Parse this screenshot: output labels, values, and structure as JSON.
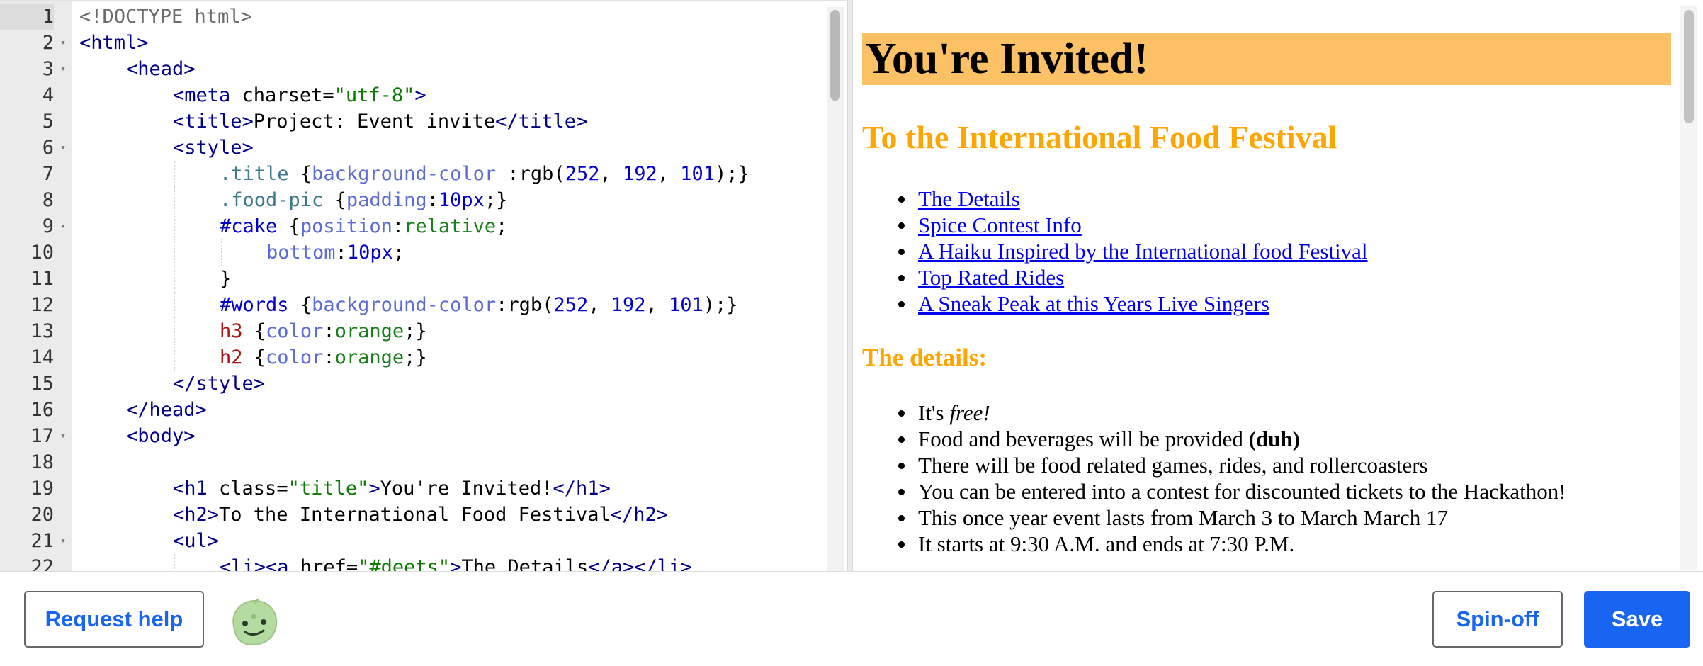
{
  "editor": {
    "lines": [
      {
        "n": "1",
        "fold": "",
        "indent": 0,
        "parts": [
          {
            "c": "t-doctype",
            "t": "<!DOCTYPE html>"
          }
        ]
      },
      {
        "n": "2",
        "fold": "▾",
        "indent": 0,
        "parts": [
          {
            "c": "t-tag",
            "t": "<html>"
          }
        ]
      },
      {
        "n": "3",
        "fold": "▾",
        "indent": 1,
        "parts": [
          {
            "c": "t-tag",
            "t": "<head>"
          }
        ]
      },
      {
        "n": "4",
        "fold": "",
        "indent": 2,
        "parts": [
          {
            "c": "t-tag",
            "t": "<meta "
          },
          {
            "c": "t-attr",
            "t": "charset"
          },
          {
            "c": "t-eq",
            "t": "="
          },
          {
            "c": "t-str",
            "t": "\"utf-8\""
          },
          {
            "c": "t-tag",
            "t": ">"
          }
        ]
      },
      {
        "n": "5",
        "fold": "",
        "indent": 2,
        "parts": [
          {
            "c": "t-tag",
            "t": "<title>"
          },
          {
            "c": "t-text",
            "t": "Project: Event invite"
          },
          {
            "c": "t-tag",
            "t": "</title>"
          }
        ]
      },
      {
        "n": "6",
        "fold": "▾",
        "indent": 2,
        "parts": [
          {
            "c": "t-tag",
            "t": "<style>"
          }
        ]
      },
      {
        "n": "7",
        "fold": "",
        "indent": 3,
        "parts": [
          {
            "c": "t-class",
            "t": ".title "
          },
          {
            "c": "t-punc",
            "t": "{"
          },
          {
            "c": "t-prop",
            "t": "background-color "
          },
          {
            "c": "t-punc",
            "t": ":rgb("
          },
          {
            "c": "t-num",
            "t": "252"
          },
          {
            "c": "t-punc",
            "t": ", "
          },
          {
            "c": "t-num",
            "t": "192"
          },
          {
            "c": "t-punc",
            "t": ", "
          },
          {
            "c": "t-num",
            "t": "101"
          },
          {
            "c": "t-punc",
            "t": ");}"
          }
        ]
      },
      {
        "n": "8",
        "fold": "",
        "indent": 3,
        "parts": [
          {
            "c": "t-class",
            "t": ".food-pic "
          },
          {
            "c": "t-punc",
            "t": "{"
          },
          {
            "c": "t-prop",
            "t": "padding"
          },
          {
            "c": "t-punc",
            "t": ":"
          },
          {
            "c": "t-num",
            "t": "10px"
          },
          {
            "c": "t-punc",
            "t": ";}"
          }
        ]
      },
      {
        "n": "9",
        "fold": "▾",
        "indent": 3,
        "parts": [
          {
            "c": "t-id",
            "t": "#cake "
          },
          {
            "c": "t-punc",
            "t": "{"
          },
          {
            "c": "t-prop",
            "t": "position"
          },
          {
            "c": "t-punc",
            "t": ":"
          },
          {
            "c": "t-val",
            "t": "relative"
          },
          {
            "c": "t-punc",
            "t": ";"
          }
        ]
      },
      {
        "n": "10",
        "fold": "",
        "indent": 4,
        "parts": [
          {
            "c": "t-prop",
            "t": "bottom"
          },
          {
            "c": "t-punc",
            "t": ":"
          },
          {
            "c": "t-num",
            "t": "10px"
          },
          {
            "c": "t-punc",
            "t": ";"
          }
        ]
      },
      {
        "n": "11",
        "fold": "",
        "indent": 3,
        "parts": [
          {
            "c": "t-punc",
            "t": "}"
          }
        ]
      },
      {
        "n": "12",
        "fold": "",
        "indent": 3,
        "parts": [
          {
            "c": "t-id",
            "t": "#words "
          },
          {
            "c": "t-punc",
            "t": "{"
          },
          {
            "c": "t-prop",
            "t": "background-color"
          },
          {
            "c": "t-punc",
            "t": ":rgb("
          },
          {
            "c": "t-num",
            "t": "252"
          },
          {
            "c": "t-punc",
            "t": ", "
          },
          {
            "c": "t-num",
            "t": "192"
          },
          {
            "c": "t-punc",
            "t": ", "
          },
          {
            "c": "t-num",
            "t": "101"
          },
          {
            "c": "t-punc",
            "t": ");}"
          }
        ]
      },
      {
        "n": "13",
        "fold": "",
        "indent": 3,
        "parts": [
          {
            "c": "t-el",
            "t": "h3 "
          },
          {
            "c": "t-punc",
            "t": "{"
          },
          {
            "c": "t-prop",
            "t": "color"
          },
          {
            "c": "t-punc",
            "t": ":"
          },
          {
            "c": "t-val",
            "t": "orange"
          },
          {
            "c": "t-punc",
            "t": ";}"
          }
        ]
      },
      {
        "n": "14",
        "fold": "",
        "indent": 3,
        "parts": [
          {
            "c": "t-el",
            "t": "h2 "
          },
          {
            "c": "t-punc",
            "t": "{"
          },
          {
            "c": "t-prop",
            "t": "color"
          },
          {
            "c": "t-punc",
            "t": ":"
          },
          {
            "c": "t-val",
            "t": "orange"
          },
          {
            "c": "t-punc",
            "t": ";}"
          }
        ]
      },
      {
        "n": "15",
        "fold": "",
        "indent": 2,
        "parts": [
          {
            "c": "t-tag",
            "t": "</style>"
          }
        ]
      },
      {
        "n": "16",
        "fold": "",
        "indent": 1,
        "parts": [
          {
            "c": "t-tag",
            "t": "</head>"
          }
        ]
      },
      {
        "n": "17",
        "fold": "▾",
        "indent": 1,
        "parts": [
          {
            "c": "t-tag",
            "t": "<body>"
          }
        ]
      },
      {
        "n": "18",
        "fold": "",
        "indent": 1,
        "parts": []
      },
      {
        "n": "19",
        "fold": "",
        "indent": 2,
        "parts": [
          {
            "c": "t-tag",
            "t": "<h1 "
          },
          {
            "c": "t-attr",
            "t": "class"
          },
          {
            "c": "t-eq",
            "t": "="
          },
          {
            "c": "t-str",
            "t": "\"title\""
          },
          {
            "c": "t-tag",
            "t": ">"
          },
          {
            "c": "t-text",
            "t": "You're Invited!"
          },
          {
            "c": "t-tag",
            "t": "</h1>"
          }
        ]
      },
      {
        "n": "20",
        "fold": "",
        "indent": 2,
        "parts": [
          {
            "c": "t-tag",
            "t": "<h2>"
          },
          {
            "c": "t-text",
            "t": "To the International Food Festival"
          },
          {
            "c": "t-tag",
            "t": "</h2>"
          }
        ]
      },
      {
        "n": "21",
        "fold": "▾",
        "indent": 2,
        "parts": [
          {
            "c": "t-tag",
            "t": "<ul>"
          }
        ]
      },
      {
        "n": "22",
        "fold": "",
        "indent": 3,
        "parts": [
          {
            "c": "t-tag",
            "t": "<li><a "
          },
          {
            "c": "t-attr",
            "t": "href"
          },
          {
            "c": "t-eq",
            "t": "="
          },
          {
            "c": "t-str",
            "t": "\"#deets\""
          },
          {
            "c": "t-tag",
            "t": ">"
          },
          {
            "c": "t-text",
            "t": "The Details"
          },
          {
            "c": "t-tag",
            "t": "</a></li>"
          }
        ]
      }
    ]
  },
  "preview": {
    "title": "You're Invited!",
    "subtitle": "To the International Food Festival",
    "links": [
      "The Details",
      "Spice Contest Info",
      "A Haiku Inspired by the International food Festival",
      "Top Rated Rides",
      "A Sneak Peak at this Years Live Singers"
    ],
    "details_heading": "The details:",
    "details": [
      {
        "before": "It's ",
        "em": "free!",
        "strong": "",
        "after": ""
      },
      {
        "before": "Food and beverages will be provided ",
        "em": "",
        "strong": "(duh)",
        "after": ""
      },
      {
        "before": "There will be food related games, rides, and rollercoasters",
        "em": "",
        "strong": "",
        "after": ""
      },
      {
        "before": "You can be entered into a contest for discounted tickets to the Hackathon!",
        "em": "",
        "strong": "",
        "after": ""
      },
      {
        "before": "This once year event lasts from March 3 to March March 17",
        "em": "",
        "strong": "",
        "after": ""
      },
      {
        "before": "It starts at 9:30 A.M. and ends at 7:30 P.M.",
        "em": "",
        "strong": "",
        "after": ""
      }
    ]
  },
  "toolbar": {
    "request_help_label": "Request help",
    "spin_off_label": "Spin-off",
    "save_label": "Save"
  },
  "icons": {
    "avatar": "green-blob-avatar-icon"
  },
  "colors": {
    "accent": "#1865f2",
    "title_bg": "rgb(252,192,101)",
    "heading": "orange"
  }
}
